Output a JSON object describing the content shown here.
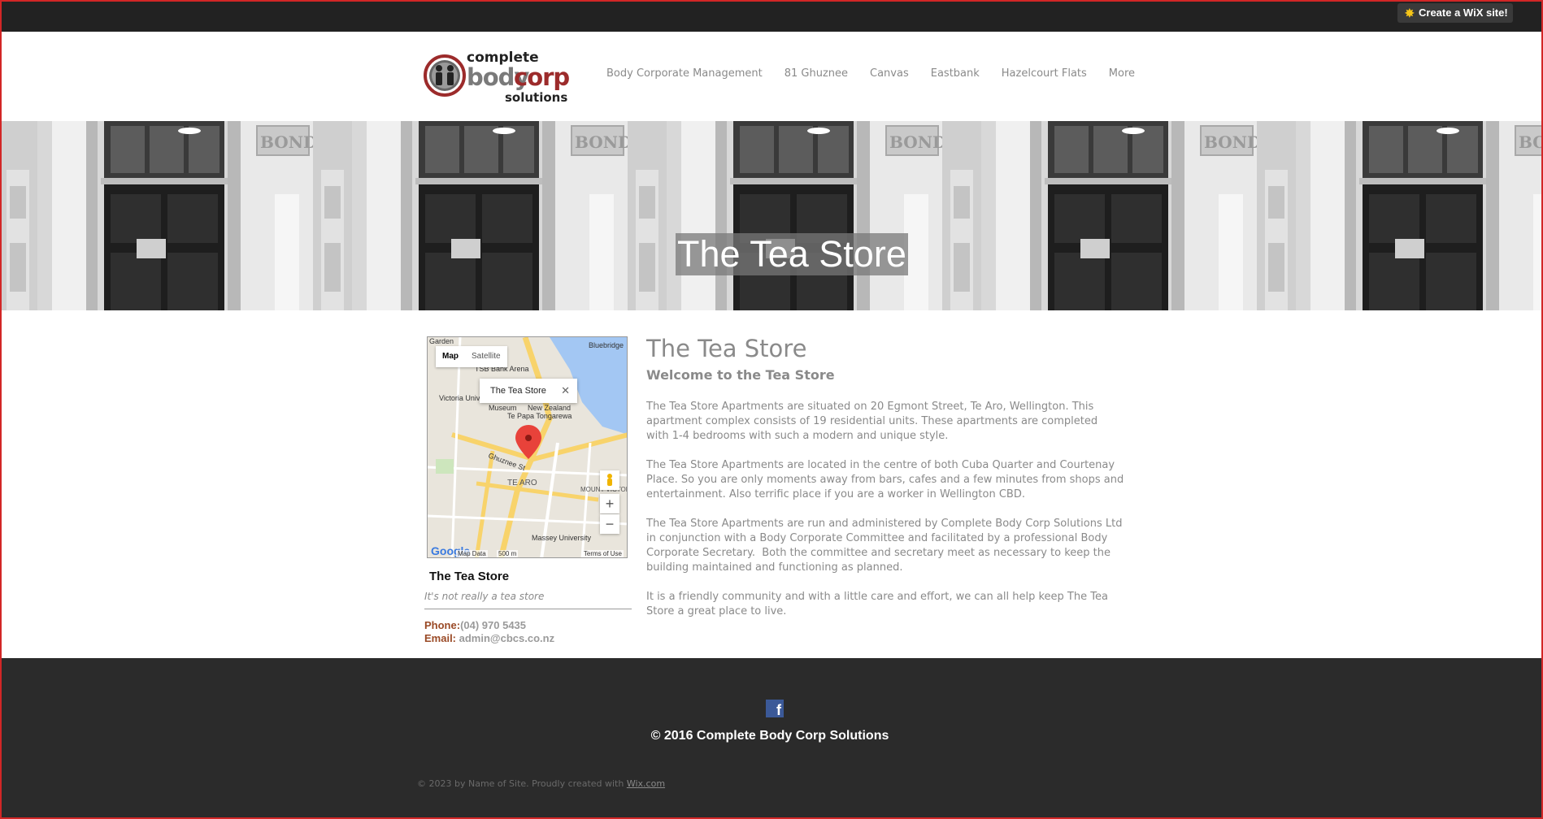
{
  "wix_bar": {
    "button_label": "Create a WiX site!"
  },
  "logo": {
    "line1": "complete",
    "body": "body",
    "corp": "corp",
    "line3": "solutions"
  },
  "nav": {
    "items": [
      {
        "label": "Body Corporate Management"
      },
      {
        "label": "81 Ghuznee"
      },
      {
        "label": "Canvas"
      },
      {
        "label": "Eastbank"
      },
      {
        "label": "Hazelcourt Flats"
      },
      {
        "label": "More"
      }
    ]
  },
  "hero": {
    "title": "The Tea Store"
  },
  "map": {
    "tab_map": "Map",
    "tab_satellite": "Satellite",
    "info_title": "The Tea Store",
    "labels": [
      "Bluebridge",
      "TSB Bank Arena",
      "Victoria University of Wellington",
      "Museum",
      "New Zealand",
      "Te Papa Tongarewa",
      "Ghuznee St",
      "TE ARO",
      "MOUNT VICTORIA",
      "Massey University",
      "Garden"
    ],
    "footer_data": "Map Data",
    "footer_scale": "500 m",
    "footer_terms": "Terms of Use",
    "google": "Google"
  },
  "place": {
    "title": "The Tea Store",
    "subtitle": "It's not really a tea store",
    "phone_label": "Phone:",
    "phone": "(04) 970 5435",
    "email_label": "Email:",
    "email": "admin@cbcs.co.nz"
  },
  "article": {
    "title": "The Tea Store",
    "subtitle": "Welcome to the Tea Store",
    "paragraphs": [
      "The Tea Store Apartments are situated on 20 Egmont Street, Te Aro, Wellington. This\napartment complex consists of 19 residential units. These apartments are completed\nwith 1-4 bedrooms with such a modern and unique style.",
      "The Tea Store Apartments are located in the centre of both Cuba Quarter and Courtenay\nPlace. So you are only moments away from bars, cafes and a few minutes from shops and\nentertainment. Also terrific place if you are a worker in Wellington CBD.",
      "The Tea Store Apartments are run and administered by Complete Body Corp Solutions Ltd\nin conjunction with a Body Corporate Committee and facilitated by a professional Body\nCorporate Secretary.  Both the committee and secretary meet as necessary to keep the\nbuilding maintained and functioning as planned.",
      "It is a friendly community and with a little care and effort, we can all help keep The Tea\nStore a great place to live."
    ]
  },
  "footer": {
    "copyright": "© 2016 Complete Body Corp Solutions",
    "credit_text": "© 2023 by Name of Site. Proudly created with ",
    "credit_link": "Wix.com"
  },
  "colors": {
    "accent_red": "#9c2b2b",
    "footer_bg": "#2b2b2b",
    "text_gray": "#8a8a8a"
  }
}
